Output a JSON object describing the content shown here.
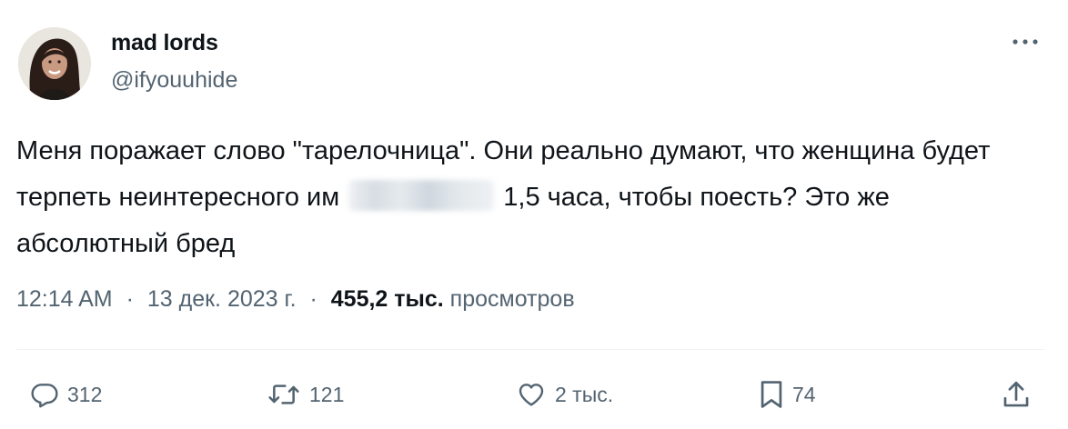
{
  "author": {
    "name": "mad lords",
    "handle": "@ifyouuhide"
  },
  "tweet": {
    "text_part1": "Меня поражает слово \"тарелочница\". Они реально думают, что женщина будет терпеть неинтересного им",
    "text_part2": "1,5 часа, чтобы поесть? Это же абсолютный бред"
  },
  "meta": {
    "time": "12:14 AM",
    "date": "13 дек. 2023 г.",
    "views_count": "455,2 тыс.",
    "views_label": "просмотров",
    "separator": "·"
  },
  "actions": {
    "replies": "312",
    "retweets": "121",
    "likes": "2 тыс.",
    "bookmarks": "74"
  },
  "icons": {
    "more": "more-horizontal-icon",
    "reply": "reply-icon",
    "retweet": "retweet-icon",
    "like": "heart-icon",
    "bookmark": "bookmark-icon",
    "share": "share-icon"
  },
  "colors": {
    "text_primary": "#0f1419",
    "text_secondary": "#536471",
    "divider": "#eff3f4"
  }
}
